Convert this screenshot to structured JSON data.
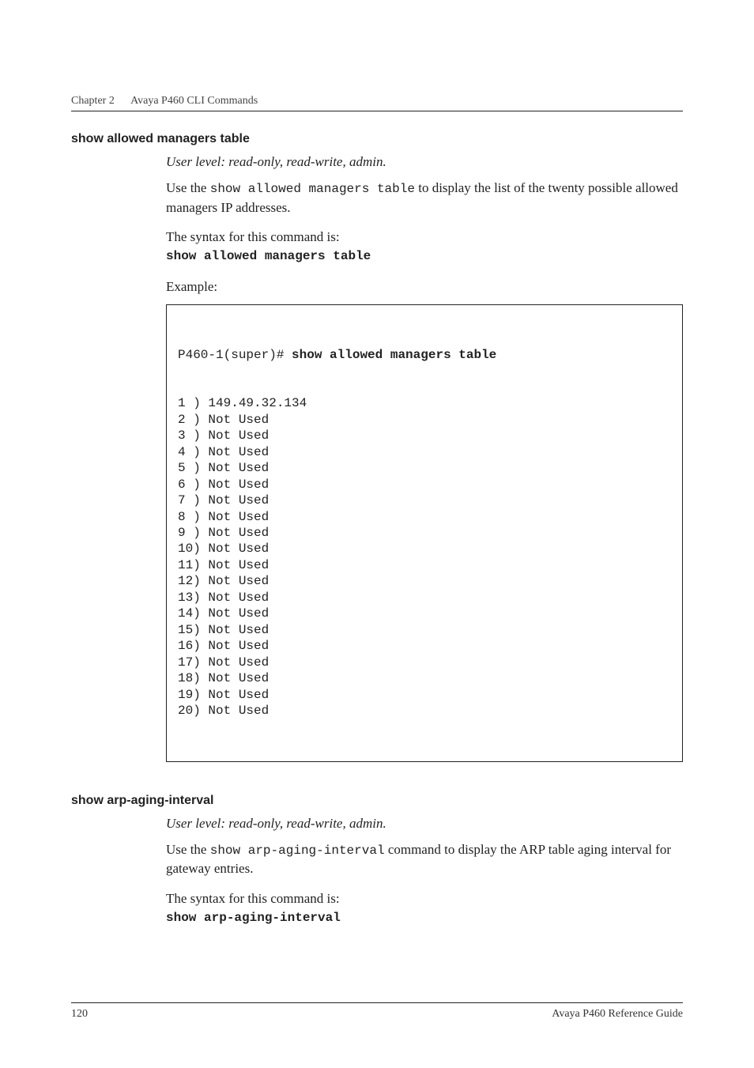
{
  "running_head": {
    "chapter": "Chapter 2",
    "title": "Avaya P460 CLI Commands"
  },
  "section1": {
    "heading": "show allowed managers table",
    "user_level": "User level: read-only, read-write, admin.",
    "intro_prefix": "Use the ",
    "intro_cmd": "show allowed managers table",
    "intro_suffix": " to display the list of the twenty possible allowed managers IP addresses.",
    "syntax_label": "The syntax for this command is:",
    "syntax_cmd": "show allowed managers table",
    "example_label": "Example:",
    "example_prompt": "P460-1(super)# ",
    "example_cmd": "show allowed managers table",
    "allowed_managers": [
      "1 ) 149.49.32.134",
      "2 ) Not Used",
      "3 ) Not Used",
      "4 ) Not Used",
      "5 ) Not Used",
      "6 ) Not Used",
      "7 ) Not Used",
      "8 ) Not Used",
      "9 ) Not Used",
      "10) Not Used",
      "11) Not Used",
      "12) Not Used",
      "13) Not Used",
      "14) Not Used",
      "15) Not Used",
      "16) Not Used",
      "17) Not Used",
      "18) Not Used",
      "19) Not Used",
      "20) Not Used"
    ]
  },
  "section2": {
    "heading": "show arp-aging-interval",
    "user_level": "User level: read-only, read-write, admin.",
    "intro_prefix": "Use the ",
    "intro_cmd": "show arp-aging-interval",
    "intro_suffix": " command to display the ARP table aging interval for gateway entries.",
    "syntax_label": "The syntax for this command is:",
    "syntax_cmd": "show arp-aging-interval"
  },
  "footer": {
    "page_number": "120",
    "doc_title": "Avaya P460 Reference Guide"
  }
}
